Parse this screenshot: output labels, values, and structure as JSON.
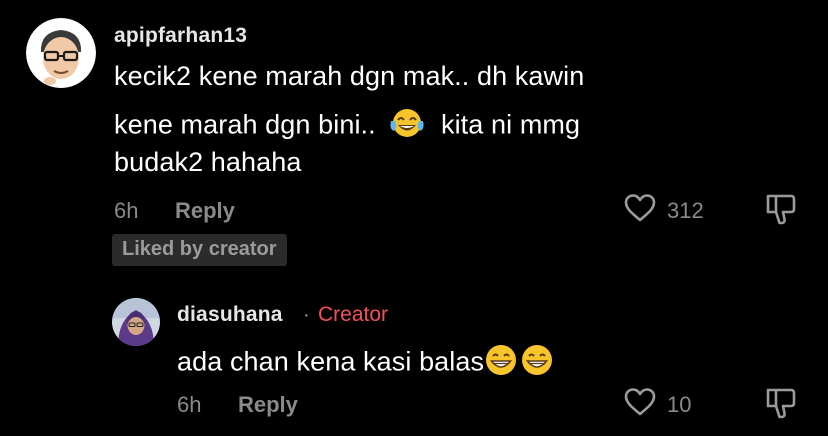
{
  "comments": [
    {
      "username": "apipfarhan13",
      "text_lines": [
        "kecik2 kene marah dgn mak.. dh kawin",
        "kene marah dgn bini..",
        "kita ni mmg",
        "budak2 hahaha"
      ],
      "emoji": "tears-of-joy-emoji",
      "time": "6h",
      "reply_label": "Reply",
      "like_count": "312",
      "badge": "Liked by creator"
    },
    {
      "username": "diasuhana",
      "separator": "·",
      "role_tag": "Creator",
      "text": "ada chan kena kasi balas",
      "emoji": "grinning-face-emoji",
      "time": "6h",
      "reply_label": "Reply",
      "like_count": "10"
    }
  ],
  "colors": {
    "background": "#000000",
    "secondary_text": "#8a8a8a",
    "creator_accent": "#f2505a",
    "badge_bg": "#2b2b2b"
  }
}
